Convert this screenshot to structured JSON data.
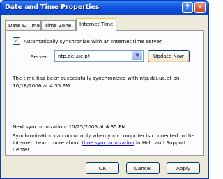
{
  "window": {
    "title": "Date and Time Properties",
    "help_label": "?",
    "close_label": "✕"
  },
  "tabs": [
    {
      "label": "Date & Time",
      "active": false
    },
    {
      "label": "Time Zone",
      "active": false
    },
    {
      "label": "Internet Time",
      "active": true
    }
  ],
  "internet_time": {
    "auto_sync_checked": true,
    "auto_sync_label": "Automatically synchronize with an Internet time server",
    "check_mark": "✓",
    "server_label": "Server:",
    "server_value": "ntp.dei.uc.pt",
    "dropdown_arrow": "▼",
    "update_now_label": "Update Now",
    "status_message": "The time has been successfully synchronized with ntp.dei.uc.pt on 10/18/2006 at 4:35 PM.",
    "next_sync": "Next synchronization: 10/25/2006 at 4:35 PM",
    "info_prefix": "Synchronization can occur only when your computer is connected to the Internet.  Learn more about ",
    "info_link": "time synchronization",
    "info_suffix": " in Help and Support Center."
  },
  "buttons": {
    "ok": "OK",
    "cancel": "Cancel",
    "apply": "Apply"
  },
  "colors": {
    "titlebar": "#0a4cd9",
    "face": "#ece9d8",
    "link": "#0000ff"
  }
}
